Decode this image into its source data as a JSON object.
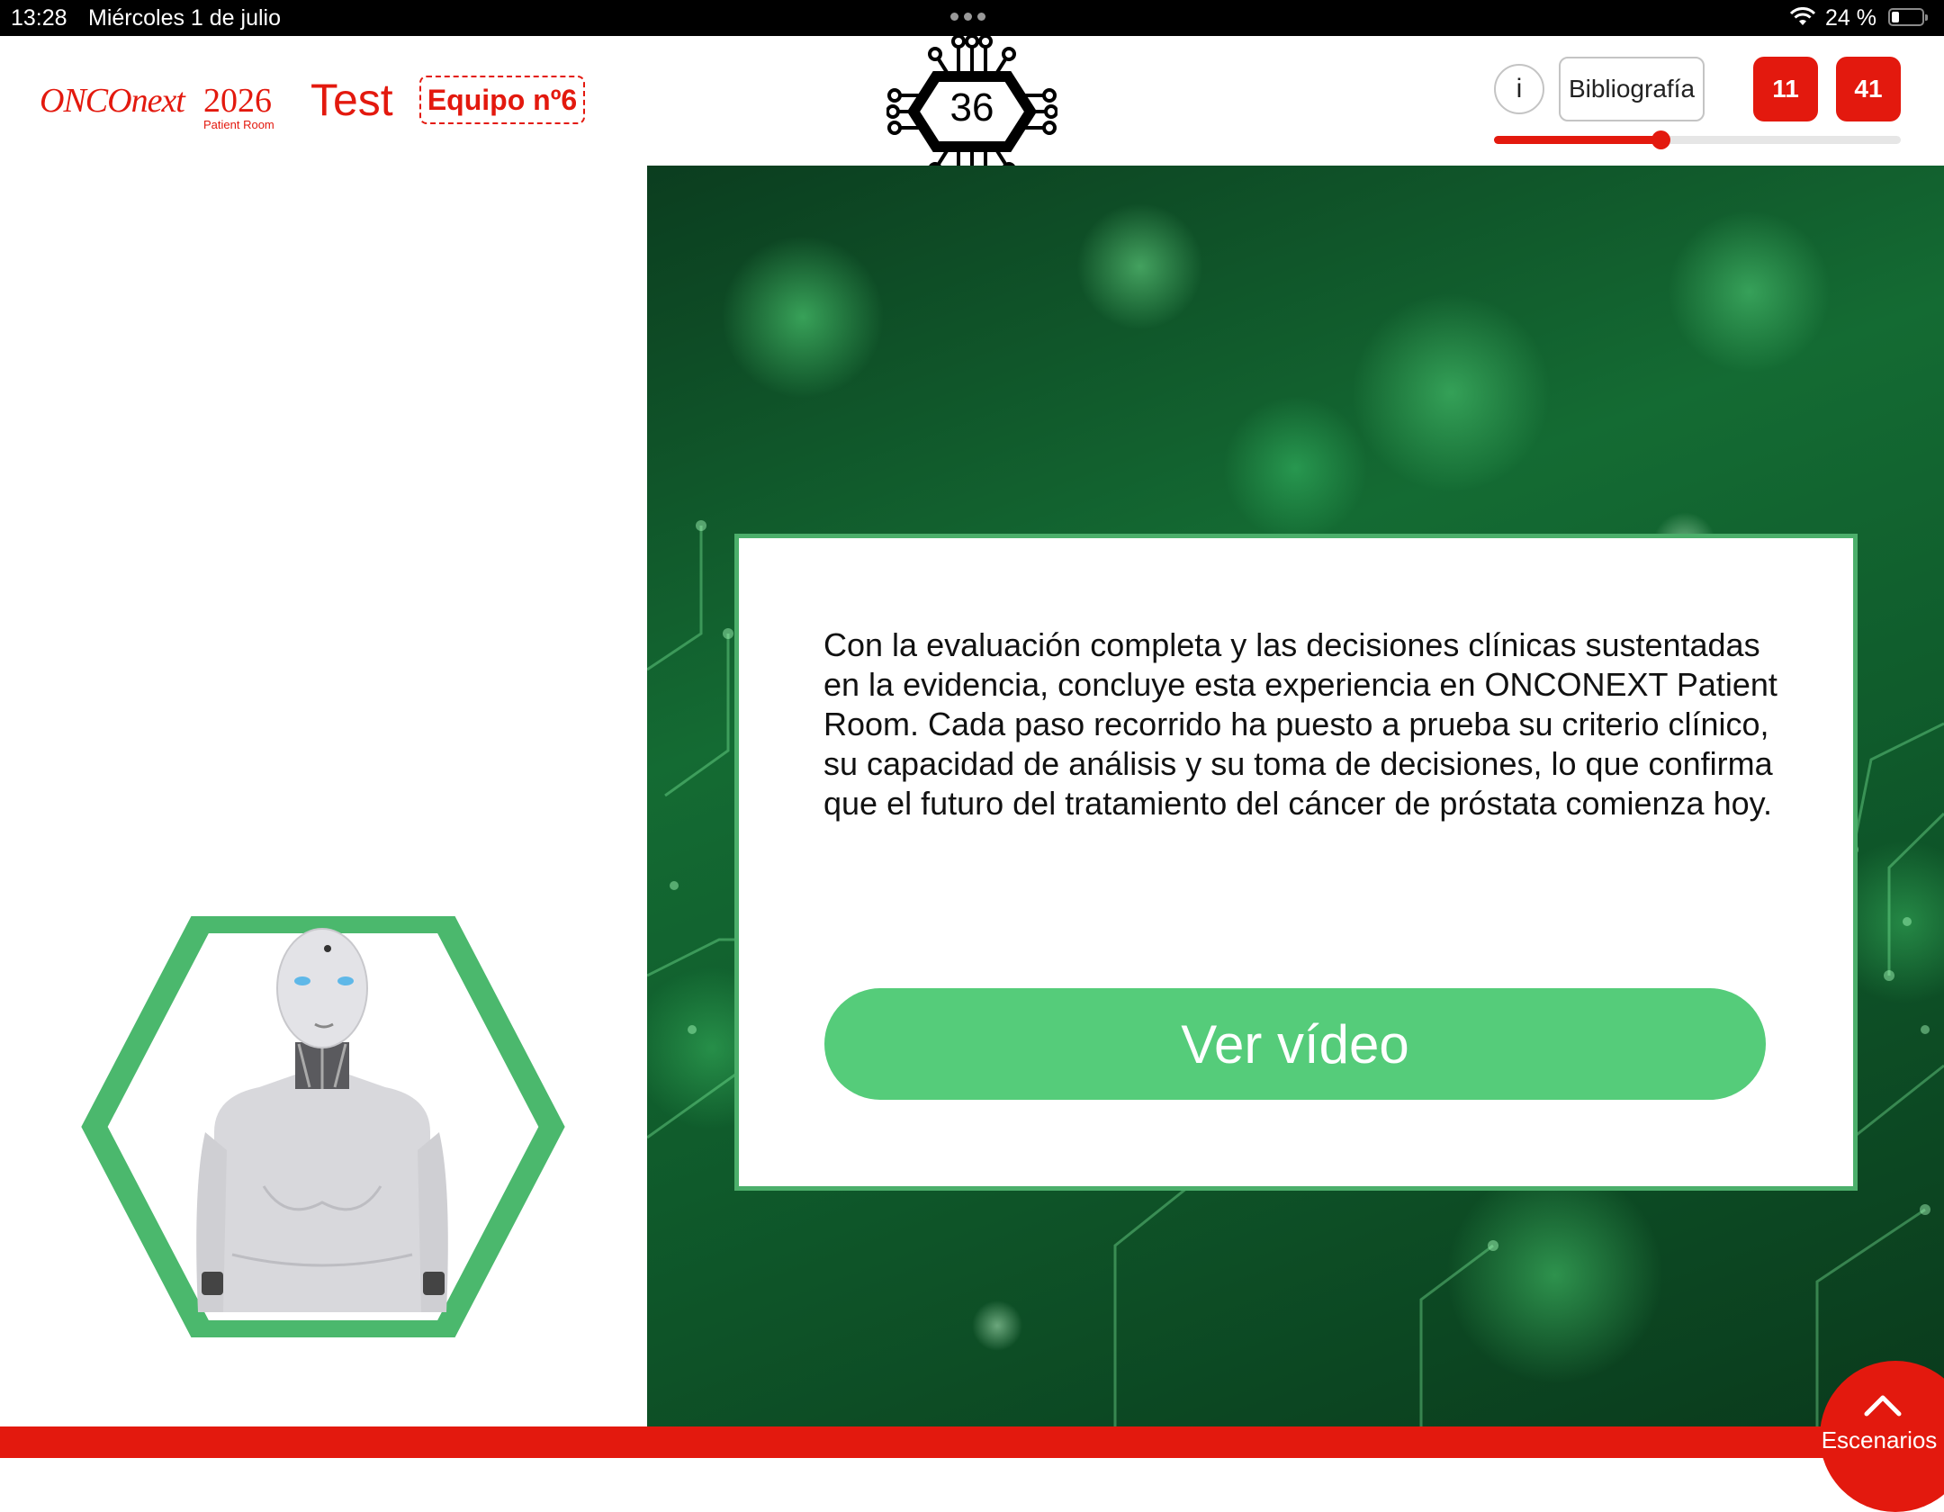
{
  "status_bar": {
    "time": "13:28",
    "date": "Miércoles 1 de julio",
    "battery_percent": "24 %",
    "battery_level": 0.24
  },
  "header": {
    "logo": {
      "brand": "ONCOnext",
      "year": "2026",
      "subtitle": "Patient Room"
    },
    "mode_label": "Test",
    "team_label": "Equipo nº6",
    "counter_value": "36",
    "info_label": "i",
    "bibliography_label": "Bibliografía",
    "badge_1": "11",
    "badge_2": "41",
    "progress_fraction": 0.41
  },
  "main": {
    "message": "Con la evaluación completa y las decisiones clínicas sustentadas en la evidencia, concluye esta experiencia en ONCONEXT Patient Room. Cada paso recorrido ha puesto a prueba su criterio clínico, su capacidad de análisis y su toma de decisiones, lo que confirma que el futuro del tratamiento del cáncer de próstata comienza hoy.",
    "video_button_label": "Ver vídeo"
  },
  "footer": {
    "scenarios_label": "Escenarios"
  },
  "colors": {
    "brand_red": "#e3190e",
    "accent_green": "#4caf6b",
    "button_green": "#55cc7a"
  }
}
